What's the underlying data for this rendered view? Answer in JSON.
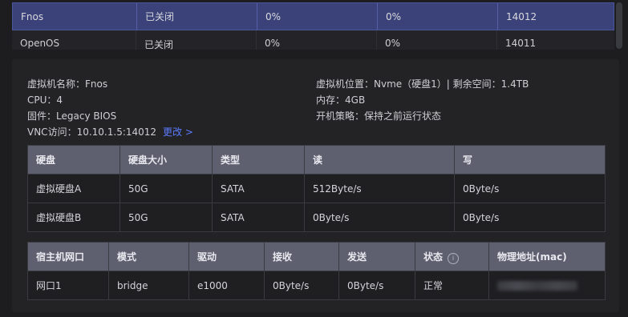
{
  "vm_list": {
    "rows": [
      {
        "name": "Fnos",
        "status": "已关闭",
        "cpu": "0%",
        "mem": "0%",
        "port": "14012"
      },
      {
        "name": "OpenOS",
        "status": "已关闭",
        "cpu": "0%",
        "mem": "0%",
        "port": "14011"
      }
    ]
  },
  "details": {
    "name_label": "虚拟机名称：",
    "name_value": "Fnos",
    "cpu_label": "CPU：",
    "cpu_value": "4",
    "firmware_label": "固件：",
    "firmware_value": "Legacy BIOS",
    "vnc_label": "VNC访问：",
    "vnc_value": "10.10.1.5:14012",
    "vnc_change_link": "更改 >",
    "location_label": "虚拟机位置：",
    "location_value": "Nvme（硬盘1）| 剩余空间：1.4TB",
    "memory_label": "内存：",
    "memory_value": "4GB",
    "power_label": "开机策略：",
    "power_value": "保持之前运行状态"
  },
  "disk_table": {
    "headers": [
      "硬盘",
      "硬盘大小",
      "类型",
      "读",
      "写"
    ],
    "rows": [
      [
        "虚拟硬盘A",
        "50G",
        "SATA",
        "512Byte/s",
        "0Byte/s"
      ],
      [
        "虚拟硬盘B",
        "50G",
        "SATA",
        "0Byte/s",
        "0Byte/s"
      ]
    ]
  },
  "net_table": {
    "headers": [
      "宿主机网口",
      "模式",
      "驱动",
      "接收",
      "发送",
      "状态",
      "物理地址(mac)"
    ],
    "rows": [
      [
        "网口1",
        "bridge",
        "e1000",
        "0Byte/s",
        "0Byte/s",
        "正常",
        ""
      ]
    ]
  },
  "colors": {
    "accent": "#5b7bff",
    "selected_row": "#3a4279",
    "header_bg": "#5e6070"
  },
  "icons": {
    "status_info": "info-circle-icon"
  }
}
